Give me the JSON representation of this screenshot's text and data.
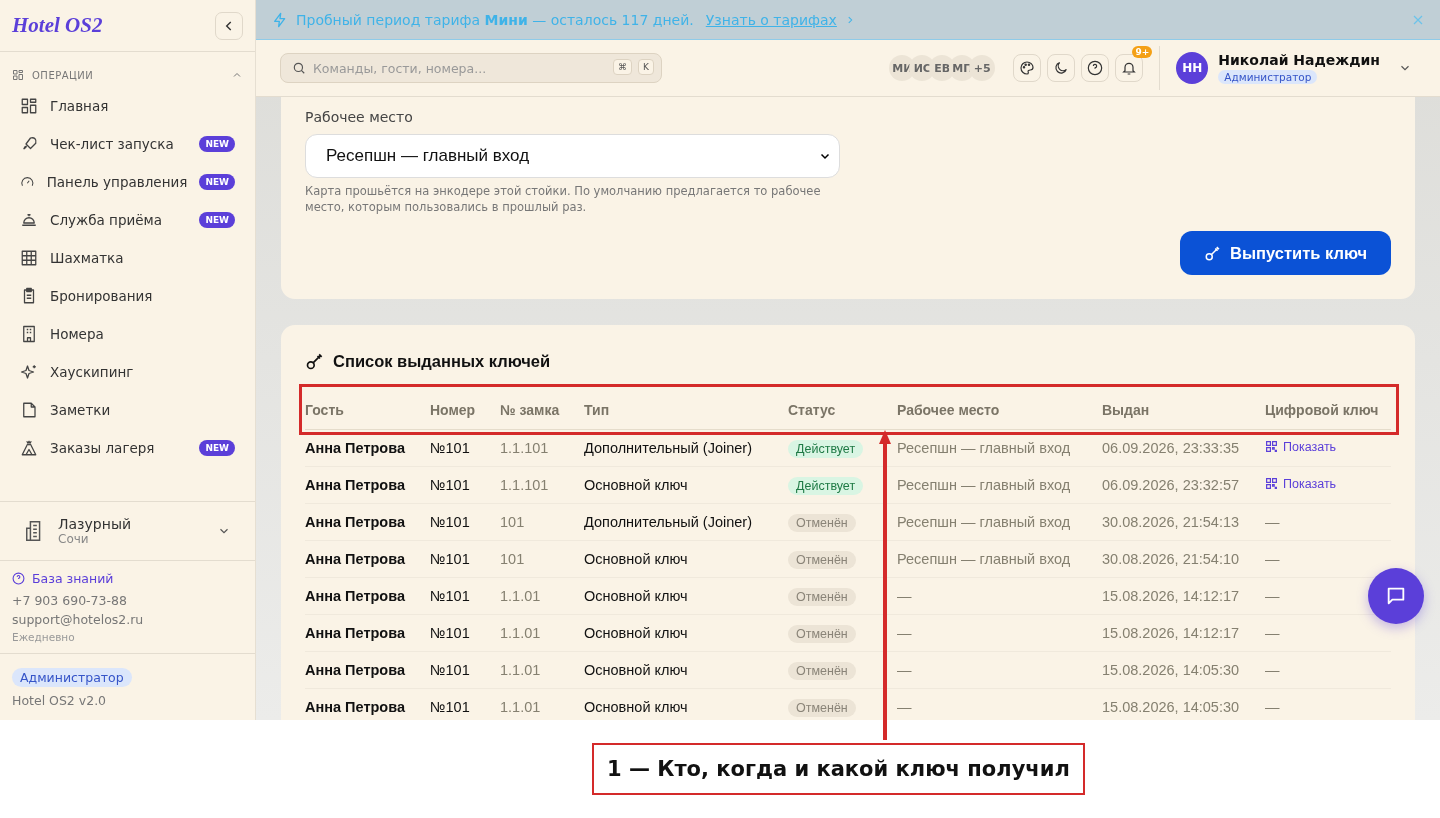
{
  "sidebar": {
    "logo": "Hotel OS2",
    "section": {
      "label": "ОПЕРАЦИИ",
      "expanded": true
    },
    "items": [
      {
        "label": "Главная"
      },
      {
        "label": "Чек-лист запуска",
        "badge": "NEW"
      },
      {
        "label": "Панель управления",
        "badge": "NEW"
      },
      {
        "label": "Служба приёма",
        "badge": "NEW"
      },
      {
        "label": "Шахматка"
      },
      {
        "label": "Бронирования"
      },
      {
        "label": "Номера"
      },
      {
        "label": "Хаускипинг"
      },
      {
        "label": "Заметки"
      },
      {
        "label": "Заказы лагеря",
        "badge": "NEW"
      }
    ],
    "property": {
      "name": "Лазурный",
      "city": "Сочи"
    },
    "help": {
      "link": "База знаний",
      "phone": "+7 903 690-73-88",
      "email": "support@hotelos2.ru",
      "hours": "Ежедневно"
    },
    "role": "Администратор",
    "version": "Hotel OS2 v2.0"
  },
  "banner": {
    "text": "Пробный период тарифа **Мини** — осталось 117 дней.",
    "link": "Узнать о тарифах"
  },
  "header": {
    "search": {
      "placeholder": "Команды, гости, номера...",
      "keys": [
        "⌘",
        "K"
      ]
    },
    "avatars": [
      "МИ",
      "ИС",
      "ЕВ",
      "МП",
      "+5"
    ],
    "notifications": "9+",
    "user": {
      "initials": "НН",
      "name": "Николай Надеждин",
      "role": "Администратор"
    }
  },
  "workplace": {
    "label": "Рабочее место",
    "value": "Ресепшн — главный вход",
    "hint": "Карта прошьётся на энкодере этой стойки. По умолчанию предлагается то рабочее место, которым пользовались в прошлый раз.",
    "button": "Выпустить ключ"
  },
  "keys": {
    "title": "Список выданных ключей",
    "columns": [
      "Гость",
      "Номер",
      "№ замка",
      "Тип",
      "Статус",
      "Рабочее место",
      "Выдан",
      "Цифровой ключ"
    ],
    "rows": [
      {
        "guest": "Анна Петрова",
        "room": "№101",
        "lock": "1.1.101",
        "type": "Дополнительный (Joiner)",
        "status": {
          "text": "Действует",
          "kind": "active"
        },
        "workplace": "Ресепшн — главный вход",
        "issued": "06.09.2026, 23:33:35",
        "digital": {
          "text": "Показать",
          "kind": "link"
        }
      },
      {
        "guest": "Анна Петрова",
        "room": "№101",
        "lock": "1.1.101",
        "type": "Основной ключ",
        "status": {
          "text": "Действует",
          "kind": "active"
        },
        "workplace": "Ресепшн — главный вход",
        "issued": "06.09.2026, 23:32:57",
        "digital": {
          "text": "Показать",
          "kind": "link"
        }
      },
      {
        "guest": "Анна Петрова",
        "room": "№101",
        "lock": "101",
        "type": "Дополнительный (Joiner)",
        "status": {
          "text": "Отменён",
          "kind": "cancelled"
        },
        "workplace": "Ресепшн — главный вход",
        "issued": "30.08.2026, 21:54:13",
        "digital": {
          "text": "—",
          "kind": "none"
        }
      },
      {
        "guest": "Анна Петрова",
        "room": "№101",
        "lock": "101",
        "type": "Основной ключ",
        "status": {
          "text": "Отменён",
          "kind": "cancelled"
        },
        "workplace": "Ресепшн — главный вход",
        "issued": "30.08.2026, 21:54:10",
        "digital": {
          "text": "—",
          "kind": "none"
        }
      },
      {
        "guest": "Анна Петрова",
        "room": "№101",
        "lock": "1.1.01",
        "type": "Основной ключ",
        "status": {
          "text": "Отменён",
          "kind": "cancelled"
        },
        "workplace": "—",
        "issued": "15.08.2026, 14:12:17",
        "digital": {
          "text": "—",
          "kind": "none"
        }
      },
      {
        "guest": "Анна Петрова",
        "room": "№101",
        "lock": "1.1.01",
        "type": "Основной ключ",
        "status": {
          "text": "Отменён",
          "kind": "cancelled"
        },
        "workplace": "—",
        "issued": "15.08.2026, 14:12:17",
        "digital": {
          "text": "—",
          "kind": "none"
        }
      },
      {
        "guest": "Анна Петрова",
        "room": "№101",
        "lock": "1.1.01",
        "type": "Основной ключ",
        "status": {
          "text": "Отменён",
          "kind": "cancelled"
        },
        "workplace": "—",
        "issued": "15.08.2026, 14:05:30",
        "digital": {
          "text": "—",
          "kind": "none"
        }
      },
      {
        "guest": "Анна Петрова",
        "room": "№101",
        "lock": "1.1.01",
        "type": "Основной ключ",
        "status": {
          "text": "Отменён",
          "kind": "cancelled"
        },
        "workplace": "—",
        "issued": "15.08.2026, 14:05:30",
        "digital": {
          "text": "—",
          "kind": "none"
        }
      }
    ]
  },
  "annotation": {
    "caption": "1 — Кто, когда и какой ключ получил"
  }
}
